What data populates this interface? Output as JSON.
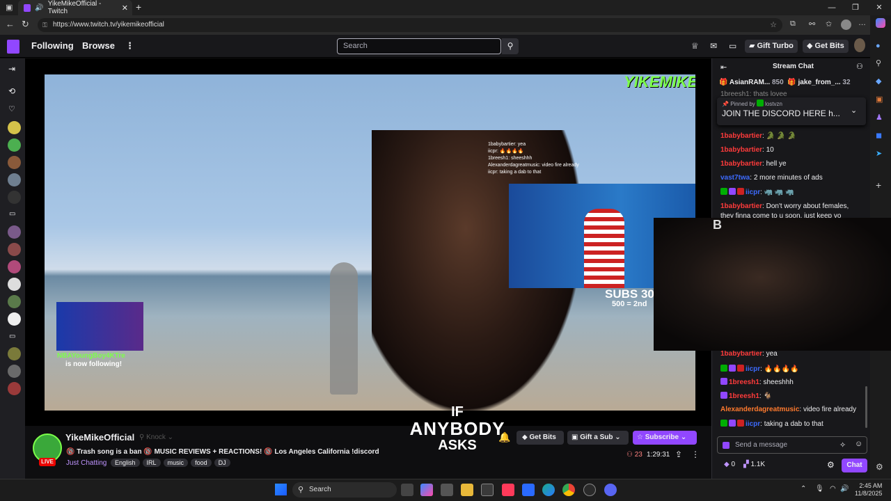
{
  "browser": {
    "tab_title": "YikeMikeOfficial - Twitch",
    "url": "https://www.twitch.tv/yikemikeofficial"
  },
  "topnav": {
    "following": "Following",
    "browse": "Browse",
    "search_placeholder": "Search",
    "gift_turbo": "Gift Turbo",
    "get_bits": "Get Bits"
  },
  "video": {
    "watermark": "YIKEMIKE",
    "follow_name": "NBAYoungBoy4KTre",
    "follow_text": "is now following!",
    "subs_text": "SUBS 30",
    "subs_sub": "500 = 2nd",
    "caption_line1": "IF",
    "caption_line2": "ANYBODY",
    "caption_line3": "ASKS",
    "overlay_chat": [
      "1babybartier: yea",
      "iicpr: 🔥🔥🔥🔥",
      "1breesh1: sheeshhh",
      "Alexanderdagreatmusic: video fire already",
      "iicpr: taking a dab to that"
    ]
  },
  "stream": {
    "channel": "YikeMikeOfficial",
    "live_badge": "LIVE",
    "knock": "Knock",
    "title": "🔞 Trash song is a ban 🔞 MUSIC REVIEWS + REACTIONS! 🔞 Los Angeles California !discord",
    "category": "Just Chatting",
    "tags": [
      "English",
      "IRL",
      "music",
      "food",
      "DJ"
    ],
    "get_bits": "Get Bits",
    "gift_sub": "Gift a Sub",
    "subscribe": "Subscribe",
    "viewers": "23",
    "uptime": "1:29:31"
  },
  "chat": {
    "header": "Stream Chat",
    "leader1_name": "AsianRAM...",
    "leader1_count": "850",
    "leader2_name": "jake_from_...",
    "leader2_count": "32",
    "partial_top": "1breesh1: thats lovee",
    "pinned_by_label": "Pinned by",
    "pinned_by_user": "lostvzn",
    "pinned_message": "JOIN THE DISCORD HERE h...",
    "messages": [
      {
        "user": "1babybartier",
        "text": "🐊 🐊 🐊",
        "color": "#ff3b3b"
      },
      {
        "user": "1babybartier",
        "text": "10",
        "color": "#ff3b3b"
      },
      {
        "user": "1babybartier",
        "text": "hell ye",
        "color": "#ff3b3b"
      },
      {
        "user": "vast7twa",
        "text": "2 more minutes of ads",
        "color": "#3d6bff"
      },
      {
        "user": "iicpr",
        "text": "🦏 🦏 🦏",
        "color": "#3d6bff"
      },
      {
        "user": "1babybartier",
        "text": "Don't worry about females, they finna come to u soon, just keep yo",
        "color": "#ff3b3b"
      },
      {
        "user": "1babybartier",
        "text": "yea",
        "color": "#ff3b3b"
      },
      {
        "user": "iicpr",
        "text": "🔥🔥🔥🔥",
        "color": "#3d6bff"
      },
      {
        "user": "1breesh1",
        "text": "sheeshhh",
        "color": "#ff3b3b"
      },
      {
        "user": "1breesh1",
        "text": "🐐",
        "color": "#ff3b3b"
      },
      {
        "user": "Alexanderdagreatmusic",
        "text": "video fire already",
        "color": "#ff7a2e"
      },
      {
        "user": "iicpr",
        "text": "taking a dab to that",
        "color": "#3d6bff"
      }
    ],
    "input_placeholder": "Send a message",
    "points": "0",
    "bits_count": "1.1K",
    "chat_button": "Chat"
  },
  "taskbar": {
    "search": "Search",
    "time": "2:45 AM",
    "date": "11/8/2025"
  }
}
